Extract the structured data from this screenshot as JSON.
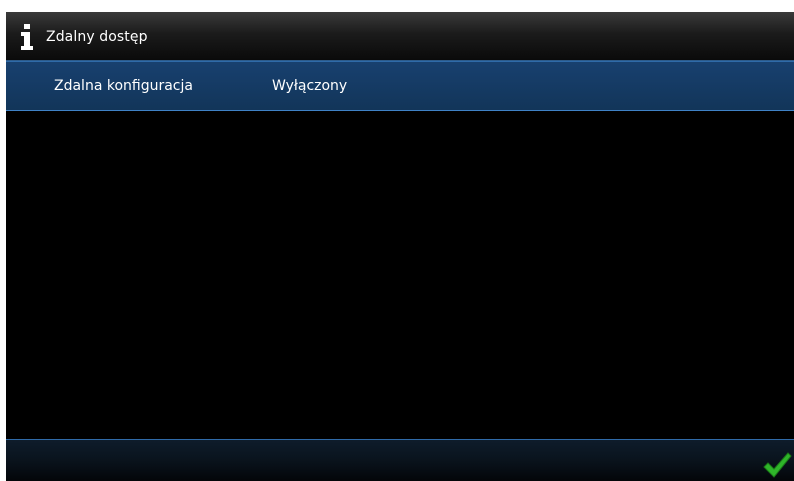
{
  "header": {
    "icon": "info-icon",
    "title": "Zdalny dostęp"
  },
  "settings": [
    {
      "label": "Zdalna konfiguracja",
      "value": "Wyłączony"
    }
  ],
  "footer": {
    "confirm_icon": "checkmark-icon",
    "confirm_color": "#2fb52a"
  },
  "colors": {
    "row_background": "#153a63",
    "accent_border": "#3f82c6",
    "background": "#000000"
  }
}
